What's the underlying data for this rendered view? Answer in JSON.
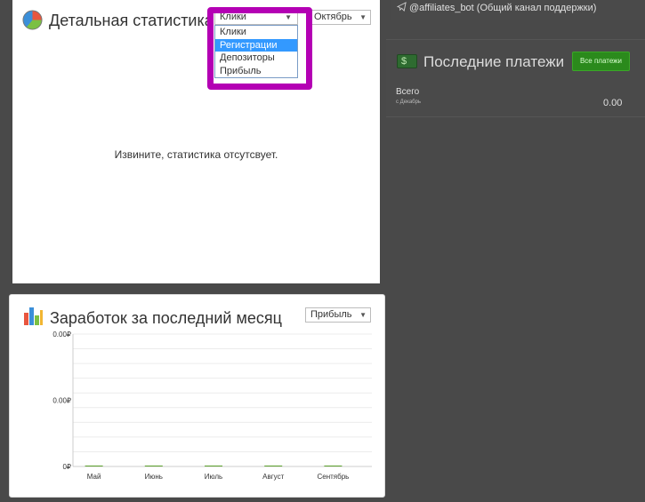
{
  "support": {
    "text": "@affiliates_bot (Общий канал поддержки)"
  },
  "stats_panel": {
    "title": "Детальная статистика",
    "metric_select": {
      "value": "Клики",
      "options": [
        "Клики",
        "Регистрации",
        "Депозиторы",
        "Прибыль"
      ],
      "highlighted": "Регистрации"
    },
    "month_select": {
      "value": "Октябрь"
    },
    "empty_message": "Извините, статистика отсутсвует."
  },
  "payments": {
    "title": "Последние платежи",
    "all_button": "Все платежи",
    "total_label": "Всего",
    "total_sub": "с Декабрь",
    "total_value": "0.00",
    "icon_glyph": "$"
  },
  "earnings": {
    "title": "Заработок за последний месяц",
    "select_value": "Прибыль"
  },
  "chart_data": {
    "type": "bar",
    "categories": [
      "Май",
      "Июнь",
      "Июль",
      "Август",
      "Сентябрь"
    ],
    "values": [
      0,
      0,
      0,
      0,
      0
    ],
    "y_tick_labels": [
      "0.00₽",
      "0.00₽",
      "0₽"
    ],
    "bar_color": "#5aa02c"
  }
}
